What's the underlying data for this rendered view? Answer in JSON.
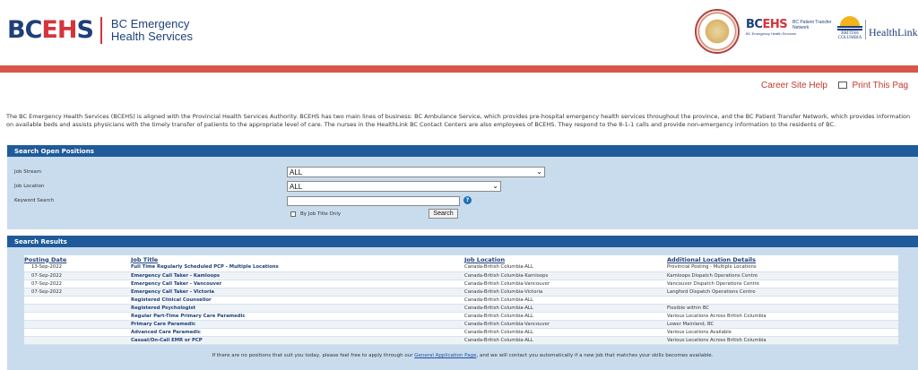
{
  "header": {
    "logo_prefix": "BC",
    "logo_highlight": "EH",
    "logo_suffix": "S",
    "org_line1": "BC Emergency",
    "org_line2": "Health Services",
    "ptn_prefix": "BC",
    "ptn_highlight": "EHS",
    "ptn_text": "BC Patient Transfer Network",
    "ptn_sub": "BC Emergency Health Services",
    "bcgov_label": "BRITISH COLUMBIA",
    "healthlink": "HealthLink"
  },
  "colors": {
    "brand_blue": "#1f3f7a",
    "brand_red": "#d6333b",
    "panel_blue": "#1f5b9a",
    "panel_bg": "#c9dced",
    "link_red": "#c0392b"
  },
  "toplinks": {
    "help": "Career Site Help",
    "print": "Print This Pag"
  },
  "intro": "The BC Emergency Health Services (BCEHS) is aligned with the Provincial Health Services Authority. BCEHS has two main lines of business: BC Ambulance Service, which provides pre-hospital emergency health services throughout the province, and the BC Patient Transfer Network, which provides information on available beds and assists physicians with the timely transfer of patients to the appropriate level of care. The nurses in the HealthLink BC Contact Centers are also employees of BCEHS. They respond to the 8-1-1 calls and provide non-emergency information to the residents of BC.",
  "search": {
    "heading": "Search Open Positions",
    "job_stream_label": "Job Stream",
    "job_stream_value": "ALL",
    "job_location_label": "Job Location",
    "job_location_value": "ALL",
    "keyword_label": "Keyword Search",
    "keyword_value": "",
    "title_only_label": "By Job Title Only",
    "search_button": "Search",
    "help_icon": "?"
  },
  "results": {
    "heading": "Search Results",
    "columns": [
      "Posting Date",
      "Job Title",
      "Job Location",
      "Additional Location Details"
    ],
    "rows": [
      [
        "13-Sep-2022",
        "Full Time Regularly Scheduled PCP - Multiple Locations",
        "Canada-British Columbia-ALL",
        "Provincial Posting - Multiple Locations"
      ],
      [
        "07-Sep-2022",
        "Emergency Call Taker - Kamloops",
        "Canada-British Columbia-Kamloops",
        "Kamloops Dispatch Operations Centre"
      ],
      [
        "07-Sep-2022",
        "Emergency Call Taker - Vancouver",
        "Canada-British Columbia-Vancouver",
        "Vancouver Dispatch Operations Centre"
      ],
      [
        "07-Sep-2022",
        "Emergency Call Taker - Victoria",
        "Canada-British Columbia-Victoria",
        "Langford Dispatch Operations Centre"
      ],
      [
        "",
        "Registered Clinical Counsellor",
        "Canada-British Columbia-ALL",
        ""
      ],
      [
        "",
        "Registered Psychologist",
        "Canada-British Columbia-ALL",
        "Flexible within BC"
      ],
      [
        "",
        "Regular Part-Time Primary Care Paramedic",
        "Canada-British Columbia-ALL",
        "Various Locations Across British Columbia"
      ],
      [
        "",
        "Primary Care Paramedic",
        "Canada-British Columbia-Vancouver",
        "Lower Mainland, BC"
      ],
      [
        "",
        "Advanced Care Paramedic",
        "Canada-British Columbia-ALL",
        "Various Locations Available"
      ],
      [
        "",
        "Casual/On-Call EMR or PCP",
        "Canada-British Columbia-ALL",
        "Various Locations Across British Columbia"
      ]
    ],
    "footnote_before": "If there are no positions that suit you today, please feel free to apply through our ",
    "footnote_link": "General Application Page",
    "footnote_after": ", and we will contact you automatically if a new job that matches your skills becomes available."
  }
}
